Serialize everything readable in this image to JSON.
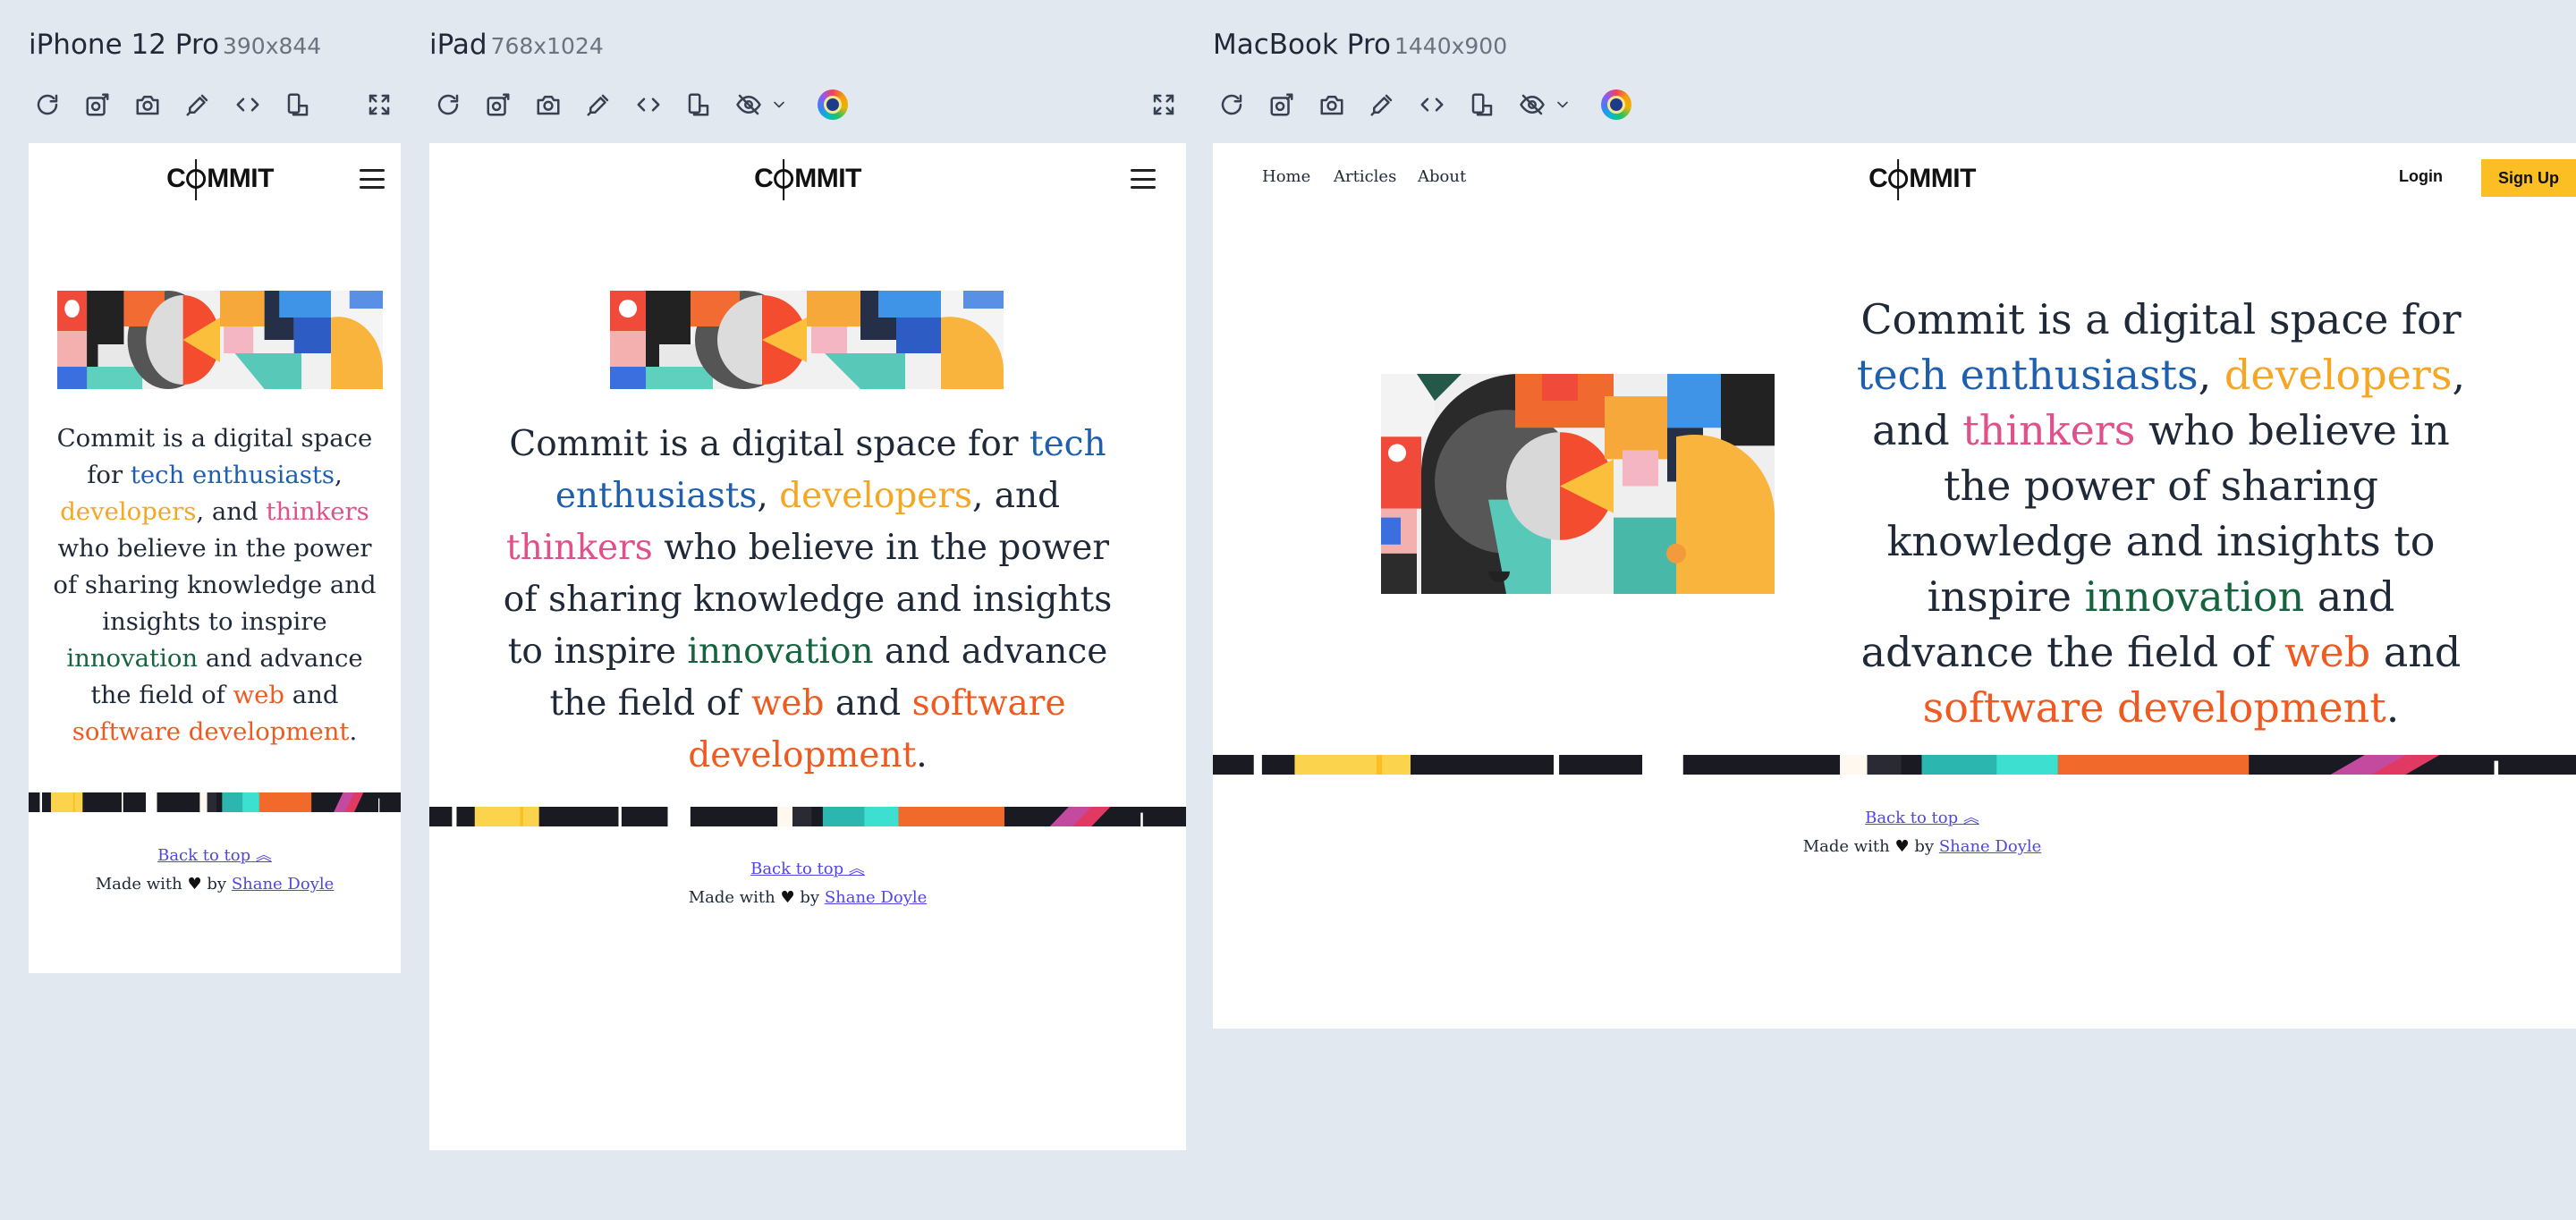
{
  "devices": [
    {
      "name": "iPhone 12 Pro",
      "size": "390x844"
    },
    {
      "name": "iPad",
      "size": "768x1024"
    },
    {
      "name": "MacBook Pro",
      "size": "1440x900"
    }
  ],
  "site": {
    "logo": {
      "before": "C",
      "after": "MMIT"
    },
    "nav": {
      "home": "Home",
      "articles": "Articles",
      "about": "About",
      "login": "Login",
      "signup": "Sign Up"
    },
    "hero": {
      "t1": "Commit is a digital space for ",
      "t2": "tech enthusiasts",
      "t3": ", ",
      "t4": "developers",
      "t5": ", and ",
      "t6": "thinkers",
      "t7": " who believe in the power of sharing knowledge and insights to inspire ",
      "t8": "innovation",
      "t9": " and advance the field of ",
      "t10": "web",
      "t11": " and ",
      "t12": "software development",
      "t13": "."
    },
    "footer": {
      "back_to_top": "Back to top",
      "made_with": "Made with",
      "by": "by",
      "author": "Shane Doyle"
    }
  },
  "colors": {
    "tech": "#1e5fae",
    "developers": "#f5a623",
    "thinkers": "#e0508a",
    "innovation": "#16633f",
    "software": "#ef5a20",
    "signup_bg": "#fbbf24",
    "link": "#4f46e5"
  },
  "icons": [
    "refresh-icon",
    "screenshot-full-icon",
    "camera-icon",
    "eyedropper-icon",
    "code-icon",
    "rotate-device-icon",
    "hide-icon",
    "chevron-down-icon",
    "color-orb-icon",
    "fullscreen-icon",
    "heart-icon",
    "double-chevron-up-icon"
  ]
}
